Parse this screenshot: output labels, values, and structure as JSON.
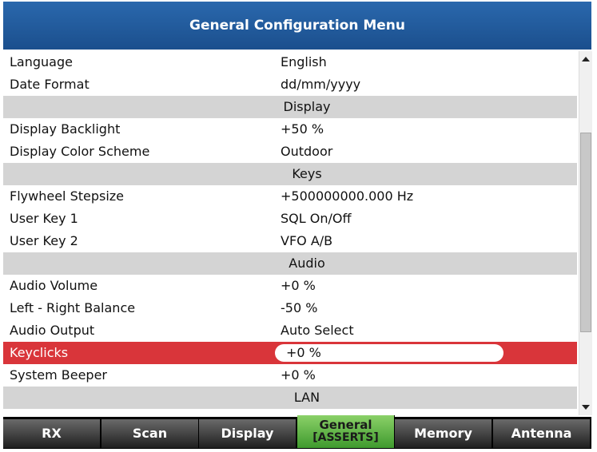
{
  "title": "General Configuration Menu",
  "rows": [
    {
      "kind": "item",
      "label": "Language",
      "value": "English"
    },
    {
      "kind": "item",
      "label": "Date Format",
      "value": "dd/mm/yyyy"
    },
    {
      "kind": "header",
      "label": "Display"
    },
    {
      "kind": "item",
      "label": "Display Backlight",
      "value": "+50 %"
    },
    {
      "kind": "item",
      "label": "Display Color Scheme",
      "value": "Outdoor"
    },
    {
      "kind": "header",
      "label": "Keys"
    },
    {
      "kind": "item",
      "label": "Flywheel Stepsize",
      "value": "+500000000.000 Hz"
    },
    {
      "kind": "item",
      "label": "User Key 1",
      "value": "SQL On/Off"
    },
    {
      "kind": "item",
      "label": "User Key 2",
      "value": "VFO A/B"
    },
    {
      "kind": "header",
      "label": "Audio"
    },
    {
      "kind": "item",
      "label": "Audio Volume",
      "value": "+0 %"
    },
    {
      "kind": "item",
      "label": "Left - Right Balance",
      "value": "-50 %"
    },
    {
      "kind": "item",
      "label": "Audio Output",
      "value": "Auto Select"
    },
    {
      "kind": "selected",
      "label": "Keyclicks",
      "value": "+0 %"
    },
    {
      "kind": "item",
      "label": "System Beeper",
      "value": "+0 %"
    },
    {
      "kind": "header",
      "label": "LAN"
    }
  ],
  "softkeys": [
    {
      "label": "RX"
    },
    {
      "label": "Scan"
    },
    {
      "label": "Display"
    },
    {
      "label": "General",
      "sublabel": "[ASSERTS]",
      "active": true
    },
    {
      "label": "Memory"
    },
    {
      "label": "Antenna"
    }
  ],
  "colors": {
    "title_bar": "#1b4f8d",
    "selected_row": "#d9353a",
    "header_row": "#d4d4d4",
    "active_softkey": "#5bb043"
  },
  "icons": {
    "scroll_up": "triangle-up-icon",
    "scroll_down": "triangle-down-icon"
  }
}
